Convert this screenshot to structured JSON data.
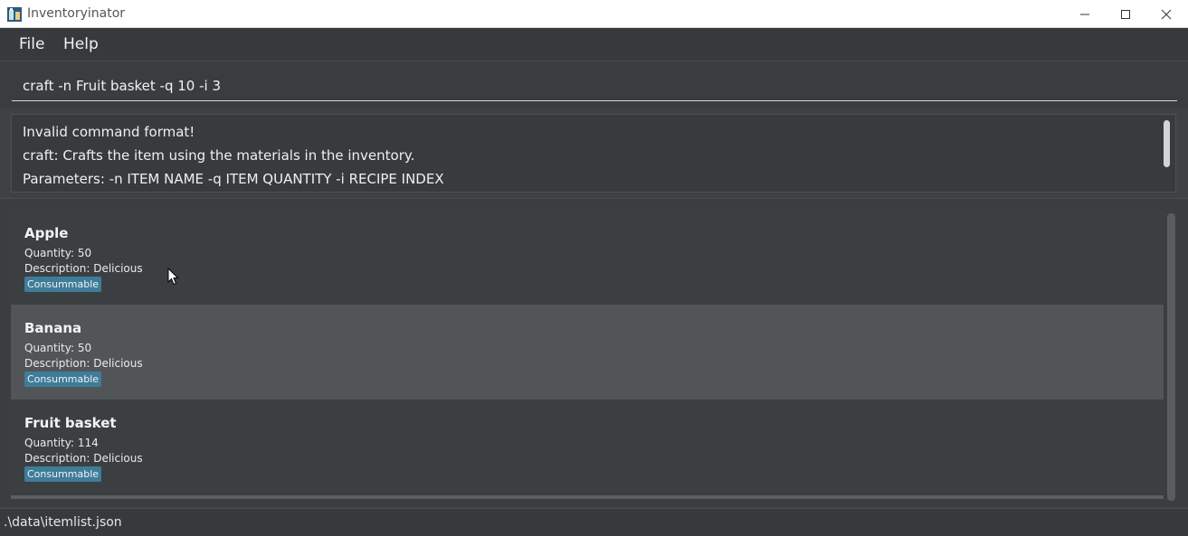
{
  "window": {
    "title": "Inventoryinator",
    "app_icon": "inventory-app-icon",
    "controls": [
      "minimize-icon",
      "maximize-icon",
      "close-icon"
    ]
  },
  "menu": {
    "items": [
      {
        "label": "File"
      },
      {
        "label": "Help"
      }
    ]
  },
  "command_box": {
    "value": "craft -n Fruit basket -q 10 -i 3"
  },
  "result_display": {
    "lines": [
      "Invalid command format!",
      "craft: Crafts the item using the materials in the inventory.",
      "Parameters: -n ITEM NAME -q ITEM QUANTITY -i RECIPE INDEX"
    ]
  },
  "items": [
    {
      "name": "Apple",
      "quantity": "Quantity: 50",
      "description": "Description: Delicious",
      "tag": "Consummable"
    },
    {
      "name": "Banana",
      "quantity": "Quantity: 50",
      "description": "Description: Delicious",
      "tag": "Consummable"
    },
    {
      "name": "Fruit basket",
      "quantity": "Quantity: 114",
      "description": "Description: Delicious",
      "tag": "Consummable"
    }
  ],
  "status_bar": {
    "file_path": ".\\data\\itemlist.json"
  },
  "colors": {
    "tag_background": "#3e7c9a",
    "card_dark": "#3c3f41",
    "card_selected": "#515558"
  }
}
